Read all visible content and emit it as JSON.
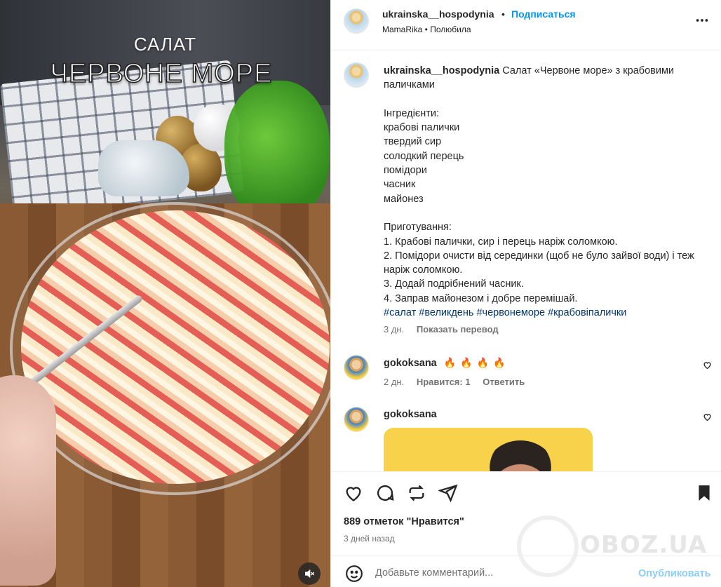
{
  "media": {
    "overlay_line1": "САЛАТ",
    "overlay_line2": "ЧЕРВОНЕ МОРЕ",
    "mute_icon": "speaker-muted-icon"
  },
  "header": {
    "username": "ukrainska__hospodynia",
    "separator": "•",
    "follow_label": "Подписаться",
    "subtitle": "MamaRika • Полюбила",
    "more_icon": "more-horizontal-icon"
  },
  "caption": {
    "username": "ukrainska__hospodynia",
    "text": " Салат «Червоне море» з крабовими паличками\n\nІнгредієнти:\nкрабові палички\nтвердий сир\nсолодкий перець\nпомідори\nчасник\nмайонез\n\nПриготування:\n1. Крабові палички, сир і перець наріж соломкою.\n2. Помідори очисти від серединки (щоб не було зайвої води) і теж наріж соломкою.\n3. Додай подрібнений часник.\n4. Заправ майонезом і добре перемішай.\n",
    "hashtags": "#салат #великдень #червонеморе #крабовіпалички",
    "time": "3 дн.",
    "translate_label": "Показать перевод"
  },
  "comments": [
    {
      "username": "gokoksana",
      "fire_count": 4,
      "time": "2 дн.",
      "likes_label": "Нравится: 1",
      "reply_label": "Ответить"
    },
    {
      "username": "gokoksana"
    }
  ],
  "actions": {
    "likes_text": "889 отметок \"Нравится\"",
    "posted_ago": "3 дней назад",
    "watermark": "OBOZ.UA"
  },
  "composer": {
    "placeholder": "Добавьте комментарий...",
    "publish_label": "Опубликовать"
  },
  "colors": {
    "accent": "#0095f6",
    "text": "#262626",
    "muted": "#737373",
    "hashtag": "#00376b",
    "fire": "#f25c05"
  }
}
